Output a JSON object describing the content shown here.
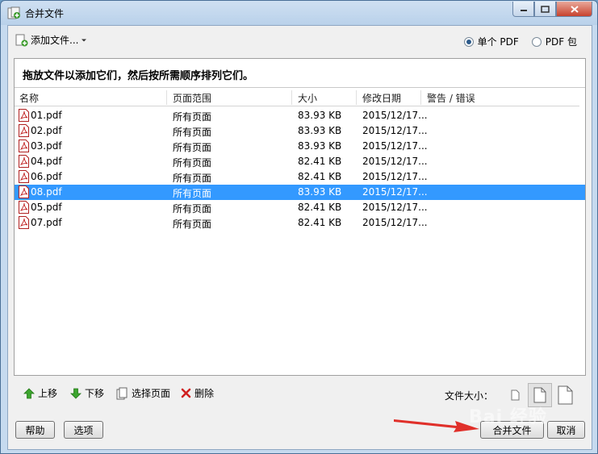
{
  "window": {
    "title": "合并文件",
    "minimize_icon": "minimize-icon",
    "maximize_icon": "maximize-icon",
    "close_icon": "close-icon"
  },
  "toolbar": {
    "add_files_label": "添加文件...",
    "add_files_icon": "add-file-icon",
    "output_options": [
      {
        "label": "单个 PDF",
        "selected": true
      },
      {
        "label": "PDF 包",
        "selected": false
      }
    ]
  },
  "file_list": {
    "instruction": "拖放文件以添加它们，然后按所需顺序排列它们。",
    "columns": [
      "名称",
      "页面范围",
      "大小",
      "修改日期",
      "警告 / 错误"
    ],
    "rows": [
      {
        "name": "01.pdf",
        "range": "所有页面",
        "size": "83.93 KB",
        "modified": "2015/12/17...",
        "warning": "",
        "selected": false
      },
      {
        "name": "02.pdf",
        "range": "所有页面",
        "size": "83.93 KB",
        "modified": "2015/12/17...",
        "warning": "",
        "selected": false
      },
      {
        "name": "03.pdf",
        "range": "所有页面",
        "size": "83.93 KB",
        "modified": "2015/12/17...",
        "warning": "",
        "selected": false
      },
      {
        "name": "04.pdf",
        "range": "所有页面",
        "size": "82.41 KB",
        "modified": "2015/12/17...",
        "warning": "",
        "selected": false
      },
      {
        "name": "06.pdf",
        "range": "所有页面",
        "size": "82.41 KB",
        "modified": "2015/12/17...",
        "warning": "",
        "selected": false
      },
      {
        "name": "08.pdf",
        "range": "所有页面",
        "size": "83.93 KB",
        "modified": "2015/12/17...",
        "warning": "",
        "selected": true
      },
      {
        "name": "05.pdf",
        "range": "所有页面",
        "size": "82.41 KB",
        "modified": "2015/12/17...",
        "warning": "",
        "selected": false
      },
      {
        "name": "07.pdf",
        "range": "所有页面",
        "size": "82.41 KB",
        "modified": "2015/12/17...",
        "warning": "",
        "selected": false
      }
    ]
  },
  "list_tools": {
    "move_up": "上移",
    "move_down": "下移",
    "choose_pages": "选择页面",
    "delete": "删除",
    "file_size_label": "文件大小："
  },
  "footer": {
    "help": "帮助",
    "options": "选项",
    "combine": "合并文件",
    "cancel": "取消"
  },
  "watermark": "Bai 经验",
  "colors": {
    "selection": "#3399ff",
    "annotation_arrow": "#e0302a"
  }
}
